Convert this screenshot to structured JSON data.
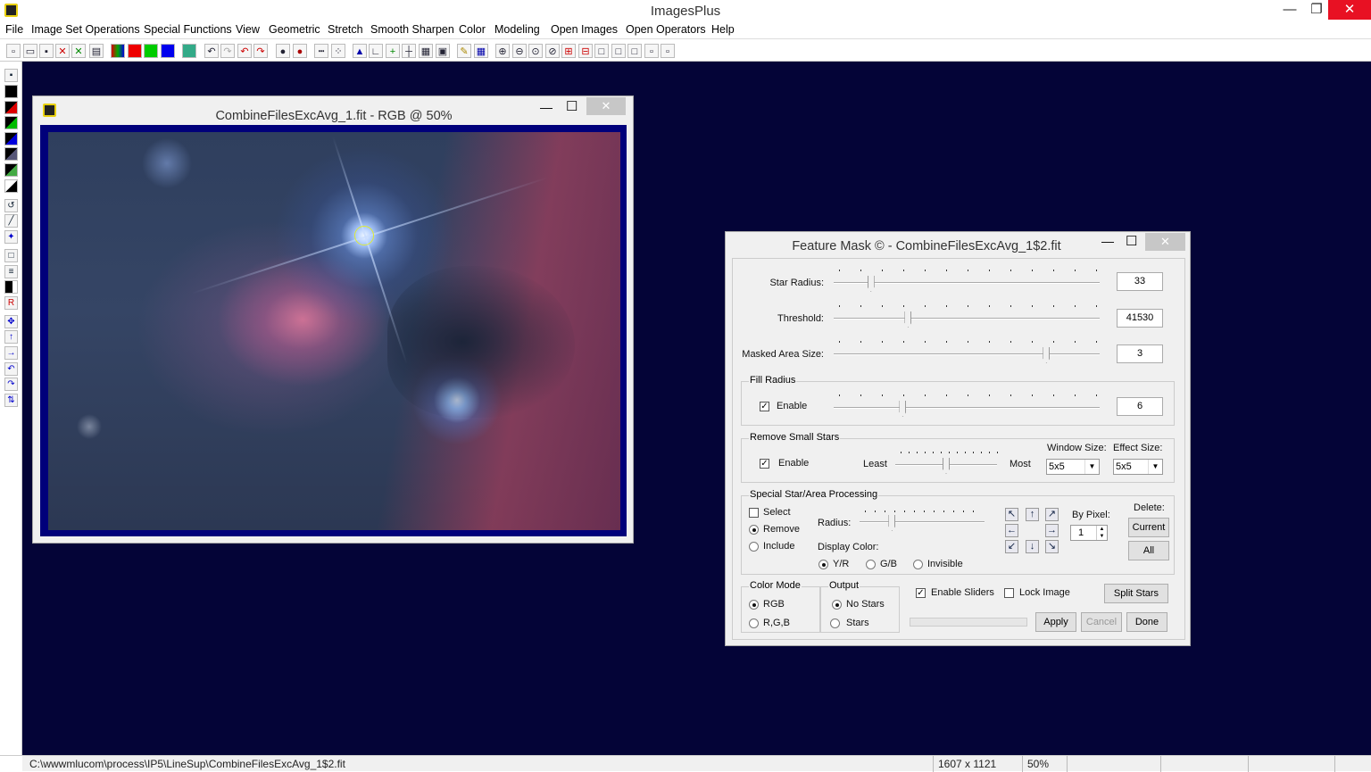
{
  "app": {
    "title": "ImagesPlus",
    "min": "—",
    "max": "❐",
    "close": "✕"
  },
  "menu": [
    "File",
    "Image Set Operations",
    "Special Functions",
    "View",
    "Geometric",
    "Stretch",
    "Smooth Sharpen",
    "Color",
    "Modeling",
    "Open Images",
    "Open Operators",
    "Help"
  ],
  "image_window": {
    "title": "CombineFilesExcAvg_1.fit - RGB @ 50%",
    "min": "—",
    "max": "☐",
    "close": "✕"
  },
  "dialog": {
    "title": "Feature Mask © - CombineFilesExcAvg_1$2.fit",
    "min": "—",
    "max": "☐",
    "close": "✕",
    "star_radius": {
      "label": "Star Radius:",
      "value": "33",
      "level": 0.14
    },
    "threshold": {
      "label": "Threshold:",
      "value": "41530",
      "level": 0.28
    },
    "masked_area": {
      "label": "Masked Area Size:",
      "value": "3",
      "level": 0.8
    },
    "fill_radius": {
      "group": "Fill Radius",
      "enable": "Enable",
      "value": "6",
      "level": 0.26
    },
    "remove_small": {
      "group": "Remove Small Stars",
      "enable": "Enable",
      "least": "Least",
      "most": "Most",
      "window_size_label": "Window Size:",
      "window_size": "5x5",
      "effect_size_label": "Effect Size:",
      "effect_size": "5x5",
      "level": 0.5
    },
    "special": {
      "group": "Special Star/Area Processing",
      "select": "Select",
      "remove": "Remove",
      "include": "Include",
      "radius": "Radius:",
      "display_color": "Display Color:",
      "yr": "Y/R",
      "gb": "G/B",
      "invisible": "Invisible",
      "by_pixel": "By Pixel:",
      "by_pixel_value": "1",
      "delete": "Delete:",
      "current": "Current",
      "all": "All",
      "level": 0.26
    },
    "color_mode": {
      "group": "Color Mode",
      "rgb": "RGB",
      "rgb2": "R,G,B"
    },
    "output": {
      "group": "Output",
      "no_stars": "No Stars",
      "stars": "Stars"
    },
    "enable_sliders": "Enable Sliders",
    "lock_image": "Lock Image",
    "split_stars": "Split Stars",
    "apply": "Apply",
    "cancel": "Cancel",
    "done": "Done"
  },
  "status": {
    "path": "C:\\wwwmlucom\\process\\IP5\\LineSup\\CombineFilesExcAvg_1$2.fit",
    "dims": "1607 x 1121",
    "zoom": "50%"
  }
}
